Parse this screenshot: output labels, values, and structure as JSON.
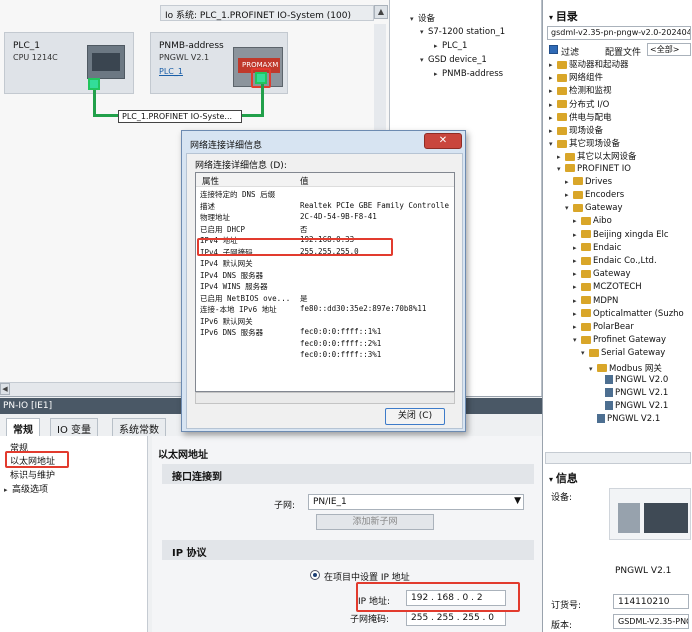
{
  "network": {
    "title": "Io 系统: PLC_1.PROFINET IO-System (100)",
    "plc": {
      "name": "PLC_1",
      "cpu": "CPU 1214C"
    },
    "gateway": {
      "name": "PNMB-address",
      "model": "PNGWL V2.1",
      "link": "PLC_1",
      "logo": "PROMAXM"
    },
    "link_label": "PLC_1.PROFINET IO-Syste..."
  },
  "tree": {
    "root": "设备",
    "items": [
      "S7-1200 station_1",
      "PLC_1",
      "GSD device_1",
      "PNMB-address"
    ]
  },
  "props": {
    "title": "PN-IO [IE1]",
    "tabs": [
      "常规",
      "IO 变量",
      "系统常数"
    ],
    "left_items": [
      "常规",
      "以太网地址",
      "标识与维护",
      "高级选项"
    ],
    "section_title": "以太网地址",
    "interface_title": "接口连接到",
    "subnet_label": "子网:",
    "subnet_value": "PN/IE_1",
    "add_subnet_btn": "添加新子网",
    "ip_protocol_title": "IP 协议",
    "radio_label": "在项目中设置 IP 地址",
    "ip_label": "IP 地址:",
    "ip_value": "192 . 168 . 0   . 2",
    "mask_label": "子网掩码:",
    "mask_value": "255 . 255 . 255 . 0"
  },
  "catalog": {
    "title": "目录",
    "search": "gsdml-v2.35-pn-pngw-v2.0-2024042",
    "filter_label": "过滤",
    "profile_label": "配置文件",
    "profile_value": "<全部>",
    "items": [
      {
        "label": "驱动器和起动器",
        "indent": 0,
        "kind": "folder"
      },
      {
        "label": "网络组件",
        "indent": 0,
        "kind": "folder"
      },
      {
        "label": "检测和监视",
        "indent": 0,
        "kind": "folder"
      },
      {
        "label": "分布式 I/O",
        "indent": 0,
        "kind": "folder"
      },
      {
        "label": "供电与配电",
        "indent": 0,
        "kind": "folder"
      },
      {
        "label": "现场设备",
        "indent": 0,
        "kind": "folder"
      },
      {
        "label": "其它现场设备",
        "indent": 0,
        "kind": "folder-open"
      },
      {
        "label": "其它以太网设备",
        "indent": 1,
        "kind": "folder"
      },
      {
        "label": "PROFINET IO",
        "indent": 1,
        "kind": "folder-open"
      },
      {
        "label": "Drives",
        "indent": 2,
        "kind": "folder"
      },
      {
        "label": "Encoders",
        "indent": 2,
        "kind": "folder"
      },
      {
        "label": "Gateway",
        "indent": 2,
        "kind": "folder-open"
      },
      {
        "label": "Aibo",
        "indent": 3,
        "kind": "folder"
      },
      {
        "label": "Beijing xingda Elc",
        "indent": 3,
        "kind": "folder"
      },
      {
        "label": "Endaic",
        "indent": 3,
        "kind": "folder"
      },
      {
        "label": "Endaic Co.,Ltd.",
        "indent": 3,
        "kind": "folder"
      },
      {
        "label": "Gateway",
        "indent": 3,
        "kind": "folder"
      },
      {
        "label": "MCZOTECH",
        "indent": 3,
        "kind": "folder"
      },
      {
        "label": "MDPN",
        "indent": 3,
        "kind": "folder"
      },
      {
        "label": "Opticalmatter (Suzho",
        "indent": 3,
        "kind": "folder"
      },
      {
        "label": "PolarBear",
        "indent": 3,
        "kind": "folder"
      },
      {
        "label": "Profinet Gateway",
        "indent": 3,
        "kind": "folder-open"
      },
      {
        "label": "Serial Gateway",
        "indent": 4,
        "kind": "folder-open"
      },
      {
        "label": "Modbus 网关",
        "indent": 5,
        "kind": "folder-open"
      },
      {
        "label": "PNGWL V2.0",
        "indent": 6,
        "kind": "doc"
      },
      {
        "label": "PNGWL V2.1",
        "indent": 6,
        "kind": "doc"
      },
      {
        "label": "PNGWL V2.1",
        "indent": 6,
        "kind": "doc"
      },
      {
        "label": "PNGWL V2.1",
        "indent": 5,
        "kind": "doc"
      }
    ],
    "info_title": "信息",
    "device_label": "设备:",
    "device_name": "PNGWL V2.1",
    "order_label": "订货号:",
    "order_value": "114110210",
    "version_label": "版本:",
    "version_value": "GSDML-V2.35-PNG"
  },
  "dialog": {
    "title": "网络连接详细信息",
    "label": "网络连接详细信息 (D):",
    "col_prop": "属性",
    "col_val": "值",
    "rows": [
      {
        "k": "连接特定的 DNS 后缀",
        "v": ""
      },
      {
        "k": "描述",
        "v": "Realtek PCIe GBE Family Controlle"
      },
      {
        "k": "物理地址",
        "v": "2C-4D-54-9B-F8-41"
      },
      {
        "k": "已启用 DHCP",
        "v": "否"
      },
      {
        "k": "IPv4 地址",
        "v": "192.168.0.33"
      },
      {
        "k": "IPv4 子网掩码",
        "v": "255.255.255.0"
      },
      {
        "k": "IPv4 默认网关",
        "v": ""
      },
      {
        "k": "IPv4 DNS 服务器",
        "v": ""
      },
      {
        "k": "IPv4 WINS 服务器",
        "v": ""
      },
      {
        "k": "已启用 NetBIOS ove...",
        "v": "是"
      },
      {
        "k": "连接-本地 IPv6 地址",
        "v": "fe80::dd30:35e2:897e:70b8%11"
      },
      {
        "k": "IPv6 默认网关",
        "v": ""
      },
      {
        "k": "IPv6 DNS 服务器",
        "v": "fec0:0:0:ffff::1%1"
      },
      {
        "k": "",
        "v": "fec0:0:0:ffff::2%1"
      },
      {
        "k": "",
        "v": "fec0:0:0:ffff::3%1"
      }
    ],
    "close_btn": "关闭 (C)"
  }
}
